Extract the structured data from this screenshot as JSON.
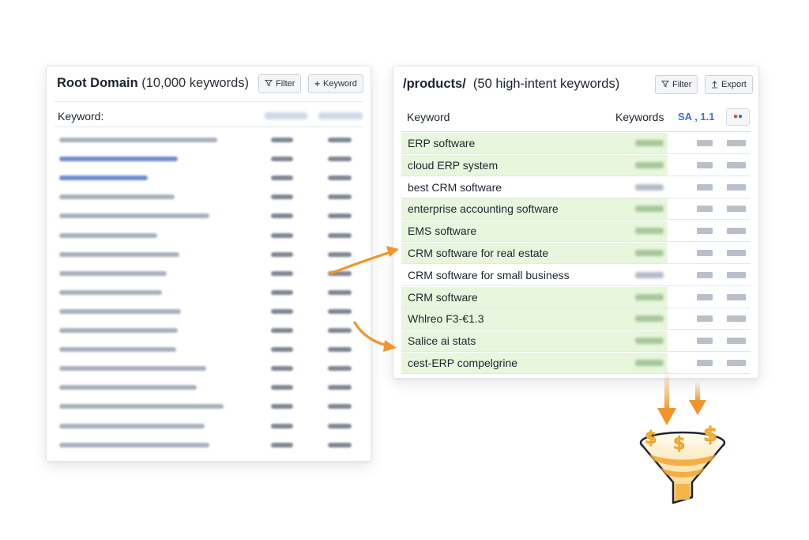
{
  "left_panel": {
    "title_bold": "Root Domain",
    "title_rest": " (10,000 keywords)",
    "filter_label": "Filter",
    "keyword_label": "Keyword",
    "filter_icon": "filter-icon",
    "add_icon": "plus-icon",
    "column_header": "Keyword:"
  },
  "right_panel": {
    "title_bold": "/products/",
    "title_rest": "  (50 high-intent keywords)",
    "filter_label": "Filter",
    "export_label": "Export",
    "filter_icon": "filter-icon",
    "export_icon": "export-icon",
    "col_keyword": "Keyword",
    "col_keywords": "Keywords",
    "col_sa": "SA , 1.1",
    "rows": [
      {
        "keyword": "ERP software",
        "highlight": true
      },
      {
        "keyword": "cloud ERP system",
        "highlight": true
      },
      {
        "keyword": "best CRM software",
        "highlight": false
      },
      {
        "keyword": "enterprise accounting software",
        "highlight": true
      },
      {
        "keyword": "EMS software",
        "highlight": true
      },
      {
        "keyword": "CRM software for real estate",
        "highlight": true
      },
      {
        "keyword": "CRM software for small business",
        "highlight": false
      },
      {
        "keyword": "CRM software",
        "highlight": true
      },
      {
        "keyword": "Whlreo F3-€1.3",
        "highlight": true
      },
      {
        "keyword": "Salice ai stats",
        "highlight": true
      },
      {
        "keyword": "cest-ERP compelgrine",
        "highlight": true
      }
    ]
  },
  "funnel": {
    "icon": "funnel-icon",
    "dollar_icon": "dollar-icon",
    "colors": {
      "arrow": "#f0952a",
      "funnel_light": "#fde0a0",
      "funnel_dark": "#f3a531",
      "dollar": "#f5b12e"
    }
  },
  "accent_colors": {
    "highlight": "#e7f6dd",
    "sa_blue": "#3a6fd8",
    "arrow_orange": "#f0952a"
  }
}
